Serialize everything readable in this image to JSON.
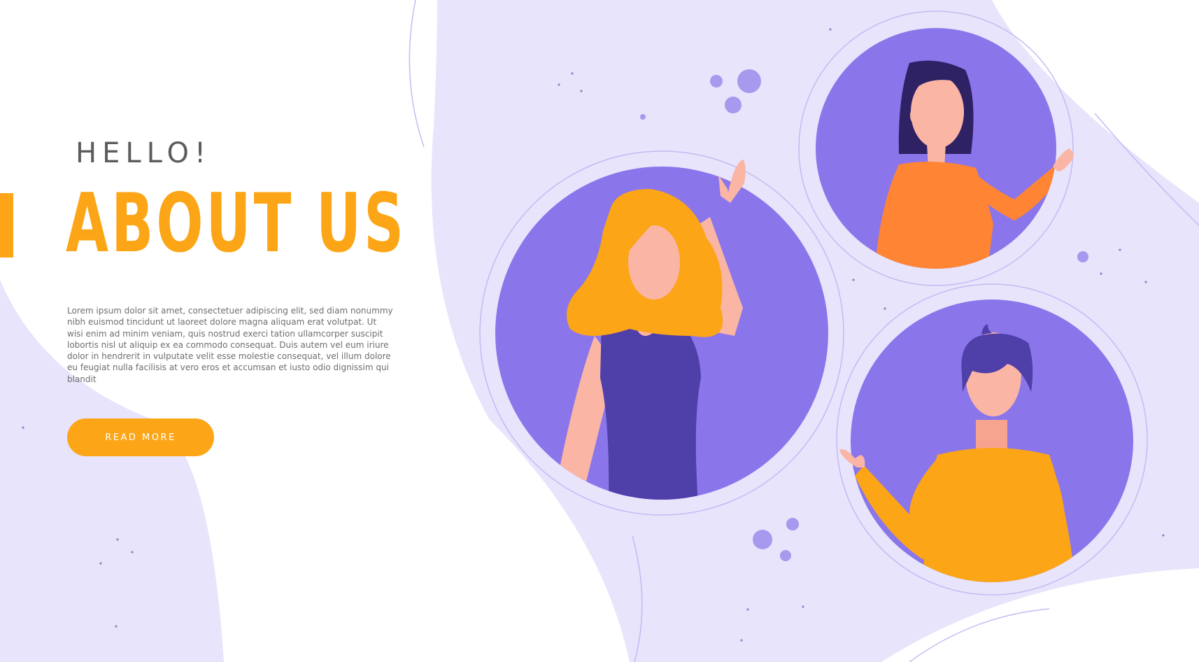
{
  "hero": {
    "greeting": "HELLO!",
    "title": "ABOUT US",
    "body": "Lorem ipsum dolor sit amet, consectetuer adipiscing elit, sed diam nonummy nibh euismod tincidunt ut laoreet dolore magna aliquam erat volutpat. Ut wisi enim ad minim veniam, quis nostrud exerci tation ullamcorper suscipit lobortis nisl ut aliquip ex ea commodo consequat. Duis autem vel eum iriure dolor in hendrerit in vulputate velit esse molestie consequat, vel illum dolore eu feugiat nulla facilisis at vero eros et accumsan et iusto odio dignissim qui blandit",
    "button_label": "READ MORE"
  },
  "colors": {
    "accent": "#FCA516",
    "lavender_background": "#E8E4FC",
    "avatar_circle": "#8A76EA",
    "heading_gray": "#5C5C5C",
    "body_gray": "#6E6E6E"
  },
  "illustration": {
    "icons": [
      "woman-waving-blonde-avatar",
      "woman-waving-dark-hair-avatar",
      "man-waving-avatar"
    ]
  }
}
